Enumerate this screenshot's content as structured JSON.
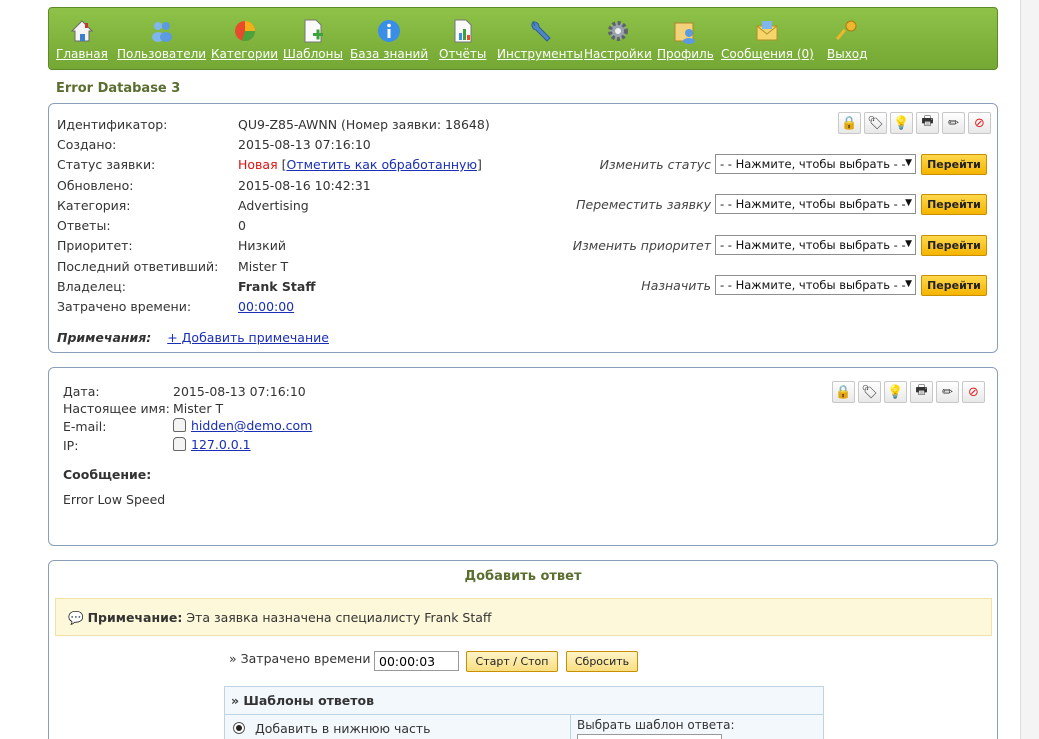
{
  "nav": {
    "items": [
      {
        "label": "Главная",
        "icon": "home-icon"
      },
      {
        "label": "Пользователи",
        "icon": "users-icon"
      },
      {
        "label": "Категории",
        "icon": "pie-chart-icon"
      },
      {
        "label": "Шаблоны",
        "icon": "template-add-icon"
      },
      {
        "label": "База знаний",
        "icon": "info-icon"
      },
      {
        "label": "Отчёты",
        "icon": "report-icon"
      },
      {
        "label": "Инструменты",
        "icon": "wrench-icon"
      },
      {
        "label": "Настройки",
        "icon": "gear-icon"
      },
      {
        "label": "Профиль",
        "icon": "profile-icon"
      },
      {
        "label": "Сообщения (0)",
        "icon": "mail-icon"
      },
      {
        "label": "Выход",
        "icon": "key-icon"
      }
    ]
  },
  "ticket": {
    "title": "Error Database 3",
    "fields": {
      "id_label": "Идентификатор:",
      "id_value": "QU9-Z85-AWNN (Номер заявки: 18648)",
      "created_label": "Создано:",
      "created_value": "2015-08-13 07:16:10",
      "status_label": "Статус заявки:",
      "status_value": "Новая",
      "status_link": "Отметить как обработанную",
      "updated_label": "Обновлено:",
      "updated_value": "2015-08-16 10:42:31",
      "category_label": "Категория:",
      "category_value": "Advertising",
      "replies_label": "Ответы:",
      "replies_value": "0",
      "priority_label": "Приоритет:",
      "priority_value": "Низкий",
      "last_replier_label": "Последний ответивший:",
      "last_replier_value": "Mister T",
      "owner_label": "Владелец:",
      "owner_value": "Frank Staff",
      "time_label": "Затрачено времени:",
      "time_value": "00:00:00"
    },
    "actions": {
      "change_status": "Изменить статус",
      "move_ticket": "Переместить заявку",
      "change_priority": "Изменить приоритет",
      "assign": "Назначить",
      "select_placeholder": "- - Нажмите, чтобы выбрать - -",
      "go_label": "Перейти"
    },
    "notes_label": "Примечания:",
    "add_note": "+ Добавить примечание"
  },
  "message": {
    "date_label": "Дата:",
    "date_value": "2015-08-13 07:16:10",
    "name_label": "Настоящее имя:",
    "name_value": "Mister T",
    "email_label": "E-mail:",
    "email_value": "hidden@demo.com",
    "ip_label": "IP:",
    "ip_value": "127.0.0.1",
    "message_label": "Сообщение:",
    "message_text": "Error Low Speed"
  },
  "reply": {
    "title": "Добавить ответ",
    "note_bold": "Примечание:",
    "note_text": "Эта заявка назначена специалисту Frank Staff",
    "time_label": "» Затрачено времени",
    "time_value": "00:00:03",
    "start_stop": "Старт / Стоп",
    "reset": "Сбросить",
    "templates_title": "» Шаблоны ответов",
    "add_bottom": "Добавить в нижнюю часть",
    "select_template": "Выбрать шаблон ответа:"
  },
  "colors": {
    "nav_green": "#7db23a",
    "title_green": "#5a6e2f",
    "status_new": "#dd1111",
    "go_button": "#f5b400",
    "note_bg": "#fdf8d9"
  }
}
